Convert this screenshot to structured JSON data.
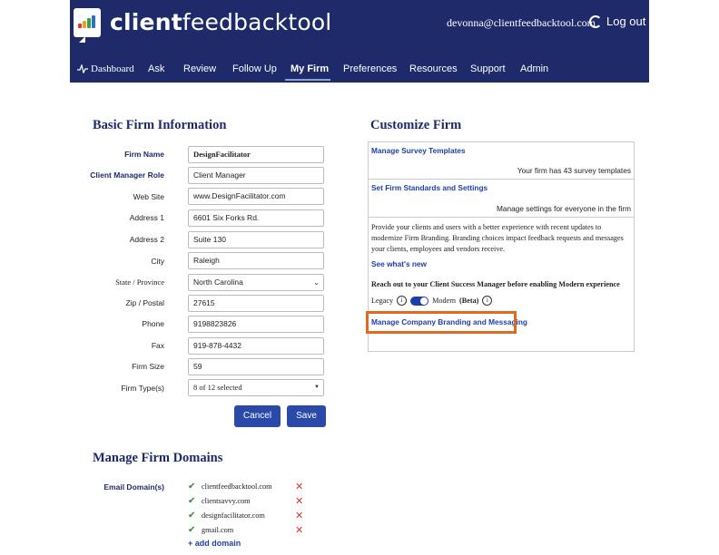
{
  "header": {
    "logo_bold": "client",
    "logo_rest": "feedbacktool",
    "user_email": "devonna@clientfeedbacktool.com",
    "logout_label": "Log out",
    "nav": [
      "Dashboard",
      "Ask",
      "Review",
      "Follow Up",
      "My Firm",
      "Preferences",
      "Resources",
      "Support",
      "Admin"
    ],
    "active_nav": "My Firm",
    "brand_color": "#1f2a6b"
  },
  "basic_info": {
    "title": "Basic Firm Information",
    "fields": [
      {
        "label": "Firm Name",
        "value": "DesignFacilitator"
      },
      {
        "label": "Client Manager Role",
        "value": "Client Manager"
      },
      {
        "label": "Web Site",
        "value": "www.DesignFacilitator.com"
      },
      {
        "label": "Address 1",
        "value": "6601 Six Forks Rd."
      },
      {
        "label": "Address 2",
        "value": "Suite 130"
      },
      {
        "label": "City",
        "value": "Raleigh"
      },
      {
        "label": "State / Province",
        "value": "North Carolina"
      },
      {
        "label": "Zip / Postal",
        "value": "27615"
      },
      {
        "label": "Phone",
        "value": "9198823826"
      },
      {
        "label": "Fax",
        "value": "919-878-4432"
      },
      {
        "label": "Firm Size",
        "value": "59"
      },
      {
        "label": "Firm Type(s)",
        "value": "8 of 12 selected"
      }
    ],
    "cancel_label": "Cancel",
    "save_label": "Save"
  },
  "customize": {
    "title": "Customize Firm",
    "survey_link": "Manage Survey Templates",
    "survey_note": "Your firm has 43 survey templates",
    "standards_link": "Set Firm Standards and Settings",
    "standards_note": "Manage settings for everyone in the firm",
    "branding_para": "Provide your clients and users with a better experience with recent updates to modernize Firm Branding. Branding choices impact feedback requests and messages your clients, employees and vendors receive.",
    "whats_new": "See what's new",
    "reach_out": "Reach out to your Client Success Manager before enabling Modern experience",
    "legacy_label": "Legacy",
    "modern_label": "Modern",
    "beta_label": "(Beta)",
    "branding_link": "Manage Company Branding and Messaging",
    "highlight_color": "#e06a1d"
  },
  "domains": {
    "title": "Manage Firm Domains",
    "label": "Email Domain(s)",
    "items": [
      "clientfeedbacktool.com",
      "clientsavvy.com",
      "designfacilitator.com",
      "gmail.com"
    ],
    "add_label": "+ add domain"
  }
}
